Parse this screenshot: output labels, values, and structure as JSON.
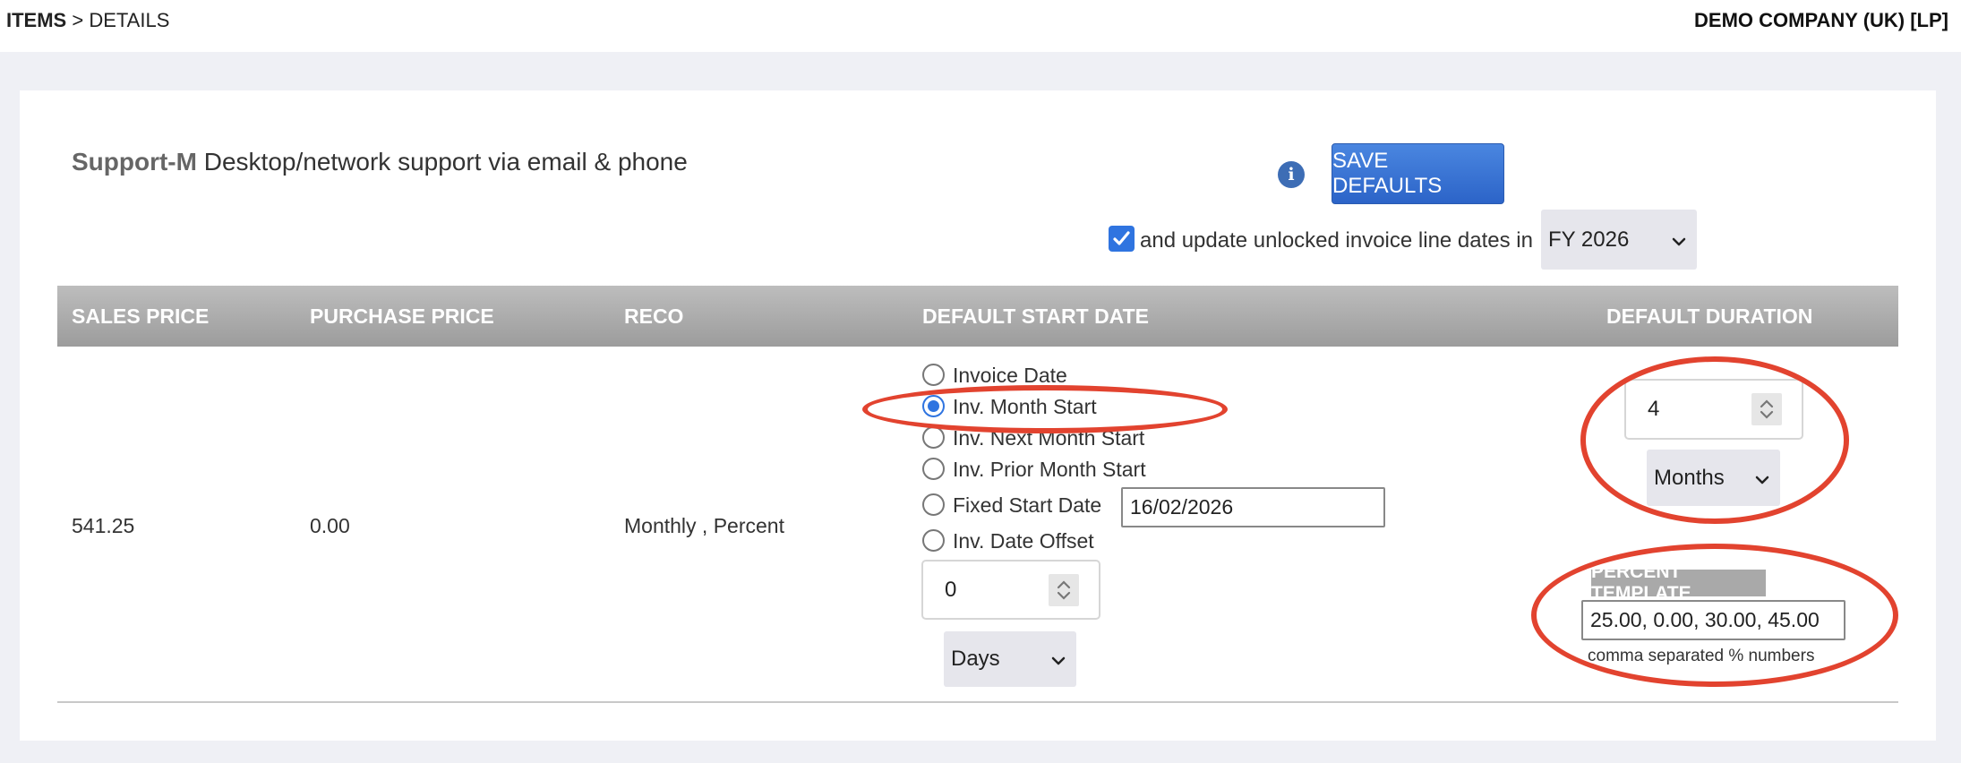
{
  "breadcrumb": {
    "root": "ITEMS",
    "separator": " > ",
    "current": "DETAILS"
  },
  "company": "DEMO COMPANY (UK) [LP]",
  "item": {
    "code": "Support-M",
    "description": "Desktop/network support via email & phone"
  },
  "toolbar": {
    "info_icon": "info-icon",
    "save_label": "SAVE DEFAULTS",
    "update_checked": true,
    "update_label": "and update unlocked invoice line dates in",
    "fy_value": "FY 2026"
  },
  "table": {
    "headers": {
      "sales_price": "SALES PRICE",
      "purchase_price": "PURCHASE PRICE",
      "reco": "RECO",
      "default_start_date": "DEFAULT START DATE",
      "default_duration": "DEFAULT DURATION"
    },
    "row": {
      "sales_price": "541.25",
      "purchase_price": "0.00",
      "reco": "Monthly , Percent"
    }
  },
  "start_date": {
    "options": [
      {
        "label": "Invoice Date",
        "selected": false
      },
      {
        "label": "Inv. Month Start",
        "selected": true
      },
      {
        "label": "Inv. Next Month Start",
        "selected": false
      },
      {
        "label": "Inv. Prior Month Start",
        "selected": false
      },
      {
        "label": "Fixed Start Date",
        "selected": false
      },
      {
        "label": "Inv. Date Offset",
        "selected": false
      }
    ],
    "fixed_date_value": "16/02/2026",
    "offset_value": "0",
    "offset_unit": "Days"
  },
  "duration": {
    "value": "4",
    "unit": "Months",
    "percent_template_label": "PERCENT TEMPLATE",
    "percent_template_value": "25.00, 0.00, 30.00, 45.00",
    "percent_template_hint": "comma separated % numbers"
  },
  "colors": {
    "accent": "#2f74e0",
    "button": "#3a74d4",
    "annotation": "#e2432f",
    "header_bg": "#a8a8a8"
  }
}
